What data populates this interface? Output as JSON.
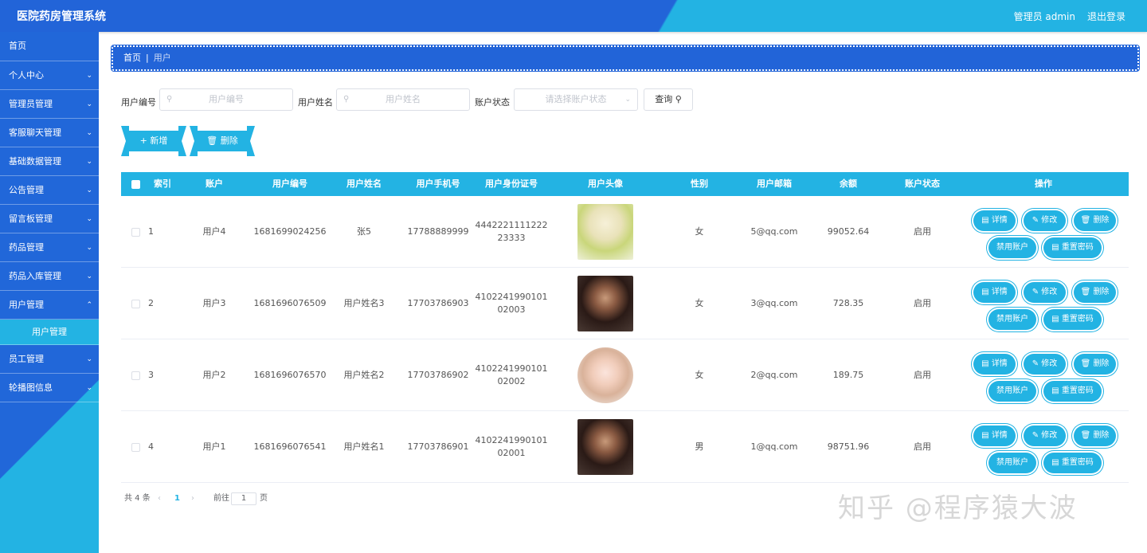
{
  "header": {
    "title": "医院药房管理系统",
    "user": "管理员 admin",
    "logout": "退出登录"
  },
  "sidebar": {
    "items": [
      {
        "label": "首页"
      },
      {
        "label": "个人中心"
      },
      {
        "label": "管理员管理"
      },
      {
        "label": "客服聊天管理"
      },
      {
        "label": "基础数据管理"
      },
      {
        "label": "公告管理"
      },
      {
        "label": "留言板管理"
      },
      {
        "label": "药品管理"
      },
      {
        "label": "药品入库管理"
      },
      {
        "label": "用户管理"
      },
      {
        "label": "员工管理"
      },
      {
        "label": "轮播图信息"
      }
    ],
    "sub_item": "用户管理"
  },
  "breadcrumb": {
    "home": "首页",
    "sep": "|",
    "current": "用户"
  },
  "search": {
    "l1": "用户编号",
    "p1": "用户编号",
    "l2": "用户姓名",
    "p2": "用户姓名",
    "l3": "账户状态",
    "p3": "请选择账户状态",
    "query": "查询"
  },
  "actions": {
    "add": "+ 新增",
    "delete": "删除"
  },
  "table": {
    "headers": [
      "索引",
      "账户",
      "用户编号",
      "用户姓名",
      "用户手机号",
      "用户身份证号",
      "用户头像",
      "性别",
      "用户邮箱",
      "余额",
      "账户状态",
      "操作"
    ],
    "rows": [
      {
        "idx": "1",
        "account": "用户4",
        "no": "1681699024256",
        "name": "张5",
        "phone": "17788889999",
        "id1": "4442221111222",
        "id2": "23333",
        "gender": "女",
        "email": "5@qq.com",
        "balance": "99052.64",
        "status": "启用"
      },
      {
        "idx": "2",
        "account": "用户3",
        "no": "1681696076509",
        "name": "用户姓名3",
        "phone": "17703786903",
        "id1": "4102241990101",
        "id2": "02003",
        "gender": "女",
        "email": "3@qq.com",
        "balance": "728.35",
        "status": "启用"
      },
      {
        "idx": "3",
        "account": "用户2",
        "no": "1681696076570",
        "name": "用户姓名2",
        "phone": "17703786902",
        "id1": "4102241990101",
        "id2": "02002",
        "gender": "女",
        "email": "2@qq.com",
        "balance": "189.75",
        "status": "启用"
      },
      {
        "idx": "4",
        "account": "用户1",
        "no": "1681696076541",
        "name": "用户姓名1",
        "phone": "17703786901",
        "id1": "4102241990101",
        "id2": "02001",
        "gender": "男",
        "email": "1@qq.com",
        "balance": "98751.96",
        "status": "启用"
      }
    ],
    "row_actions": {
      "detail": "详情",
      "edit": "修改",
      "delete": "删除",
      "disable": "禁用账户",
      "reset": "重置密码"
    }
  },
  "pager": {
    "total": "共 4 条",
    "page": "1",
    "goto": "前往",
    "goto_val": "1",
    "page_unit": "页"
  },
  "watermark": "知乎 @程序猿大波",
  "colors": {
    "primary_blue": "#2264d8",
    "accent_cyan": "#23b3e3"
  }
}
